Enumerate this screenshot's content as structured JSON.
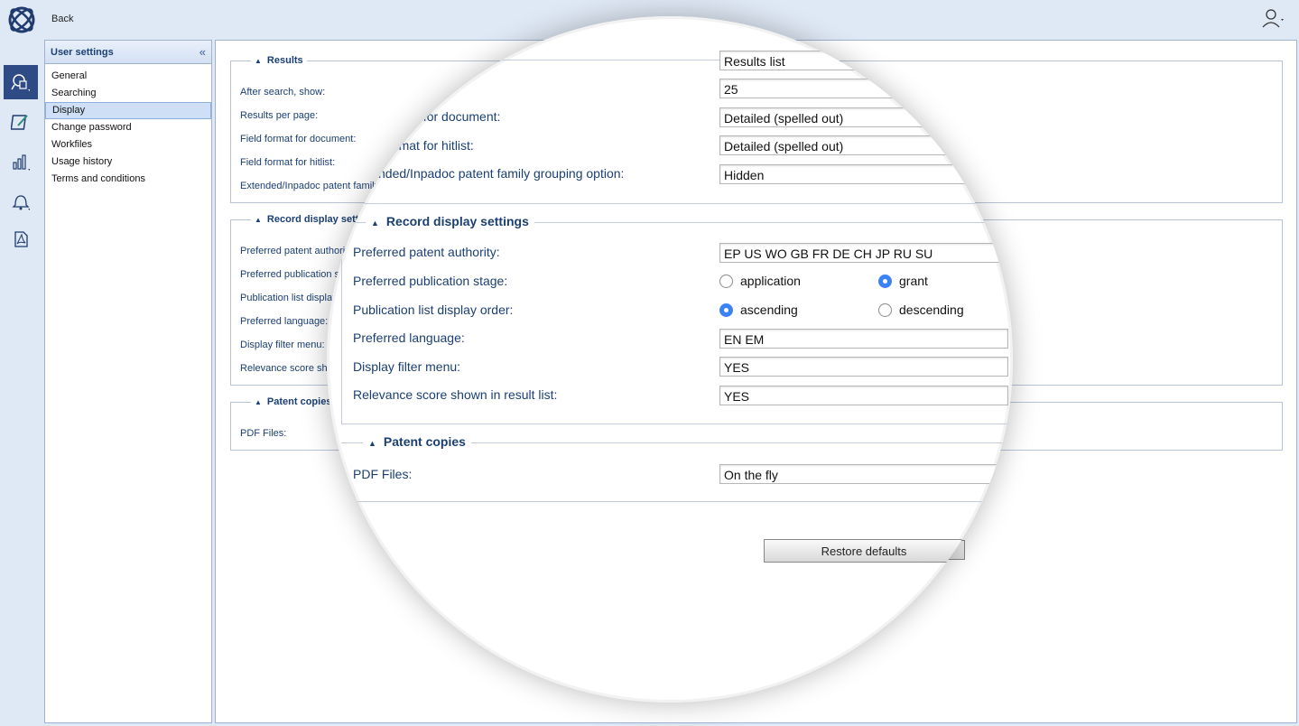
{
  "topbar": {
    "back_label": "Back"
  },
  "rail": {
    "items": [
      {
        "icon": "search-document-icon",
        "active": true
      },
      {
        "icon": "edit-note-icon"
      },
      {
        "icon": "bar-chart-icon"
      },
      {
        "icon": "bell-icon"
      },
      {
        "icon": "pdf-icon"
      }
    ]
  },
  "nav": {
    "title": "User settings",
    "collapse_glyph": "«",
    "items": [
      "General",
      "Searching",
      "Display",
      "Change password",
      "Workfiles",
      "Usage history",
      "Terms and conditions"
    ],
    "selected": "Display"
  },
  "results": {
    "legend": "Results",
    "rows": [
      {
        "label": "After search, show:",
        "value": "Results list"
      },
      {
        "label": "Results per page:",
        "value": "25"
      },
      {
        "label": "Field format for document:",
        "value": "Detailed (spelled out)"
      },
      {
        "label": "Field format for hitlist:",
        "value": "Detailed (spelled out)"
      },
      {
        "label": "Extended/Inpadoc patent family grouping option:",
        "value": "Hidden"
      }
    ]
  },
  "record": {
    "legend": "Record display settings",
    "authority": {
      "label": "Preferred patent authority:",
      "value": "EP US WO GB FR DE CH JP RU SU"
    },
    "stage": {
      "label": "Preferred publication stage:",
      "options": [
        "application",
        "grant"
      ],
      "selected": "grant"
    },
    "order": {
      "label": "Publication list display order:",
      "options": [
        "ascending",
        "descending"
      ],
      "selected": "ascending"
    },
    "language": {
      "label": "Preferred language:",
      "value": "EN EM"
    },
    "filter": {
      "label": "Display filter menu:",
      "value": "YES"
    },
    "relevance": {
      "label": "Relevance score shown in result list:",
      "value": "YES"
    }
  },
  "copies": {
    "legend": "Patent copies",
    "pdf": {
      "label": "PDF Files:",
      "value": "On the fly"
    }
  },
  "restore_label": "Restore defaults",
  "colors": {
    "accent": "#2f4b86",
    "text": "#1b3f73",
    "radio_on": "#3b82f6"
  }
}
